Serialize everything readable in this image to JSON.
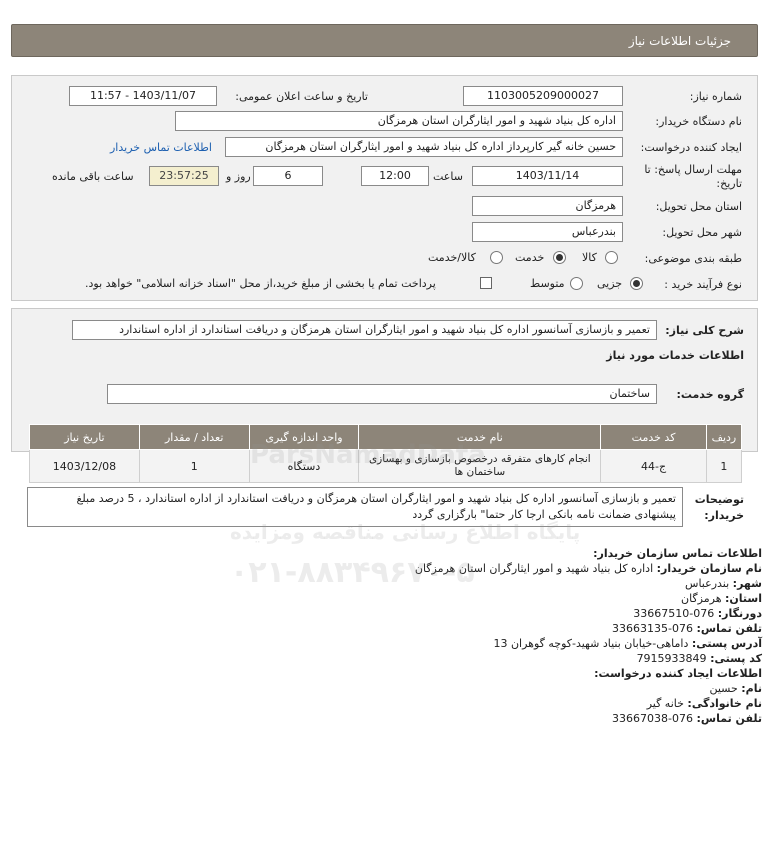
{
  "header": {
    "title": "جزئیات اطلاعات نیاز"
  },
  "form": {
    "need_number_label": "شماره نیاز:",
    "need_number": "1103005209000027",
    "announce_label": "تاریخ و ساعت اعلان عمومی:",
    "announce_value": "1403/11/07 - 11:57",
    "buyer_org_label": "نام دستگاه خریدار:",
    "buyer_org": "اداره کل بنیاد شهید و امور ایثارگران استان هرمزگان",
    "creator_label": "ایجاد کننده درخواست:",
    "creator": "حسین خانه گیر کارپرداز اداره کل بنیاد شهید و امور ایثارگران استان هرمزگان",
    "contact_link": "اطلاعات تماس خریدار",
    "deadline_label": "مهلت ارسال پاسخ: تا تاریخ:",
    "deadline_date": "1403/11/14",
    "time_label": "ساعت",
    "deadline_time": "12:00",
    "days_value": "6",
    "days_label": "روز و",
    "remaining_time": "23:57:25",
    "remaining_label": "ساعت باقی مانده",
    "province_label": "استان محل تحویل:",
    "province": "هرمزگان",
    "city_label": "شهر محل تحویل:",
    "city": "بندرعباس",
    "category_label": "طبقه بندی موضوعی:",
    "category_options": [
      "کالا",
      "خدمت",
      "کالا/خدمت"
    ],
    "category_selected": "خدمت",
    "process_label": "نوع فرآیند خرید :",
    "process_options": [
      "جزیی",
      "متوسط"
    ],
    "process_selected": "جزیی",
    "payment_note": "پرداخت تمام یا بخشی از مبلغ خرید،از محل \"اسناد خزانه اسلامی\" خواهد بود."
  },
  "description": {
    "label": "شرح کلی نیاز:",
    "text": "تعمیر و بازسازی آسانسور اداره کل بنیاد شهید و امور ایثارگران استان هرمزگان و دریافت استاندارد از اداره استاندارد"
  },
  "services": {
    "section_title": "اطلاعات خدمات مورد نیاز",
    "group_label": "گروه خدمت:",
    "group_value": "ساختمان",
    "columns": [
      "ردیف",
      "کد خدمت",
      "نام خدمت",
      "واحد اندازه گیری",
      "تعداد / مقدار",
      "تاریخ نیاز"
    ],
    "rows": [
      {
        "row": "1",
        "code": "ج-44",
        "name": "انجام کارهای متفرقه درخصوص بازسازی و بهسازی ساختمان ها",
        "unit": "دستگاه",
        "qty": "1",
        "date": "1403/12/08"
      }
    ]
  },
  "buyer_notes": {
    "label": "توضیحات خریدار:",
    "text": "تعمیر و بازسازی آسانسور اداره کل بنیاد شهید و امور ایثارگران استان هرمزگان و دریافت استاندارد از اداره استاندارد ، 5 درصد مبلغ پیشنهادی ضمانت نامه بانکی ارجا کار حتما\" بارگزاری گردد"
  },
  "contact": {
    "title": "اطلاعات تماس سازمان خریدار:",
    "org_label": "نام سازمان خریدار:",
    "org": "اداره کل بنیاد شهید و امور ایثارگران استان هرمزگان",
    "city_label": "شهر:",
    "city": "بندرعباس",
    "province_label": "استان:",
    "province": "هرمزگان",
    "fax_label": "دورنگار:",
    "fax": "076-33667510",
    "phone_label": "تلفن تماس:",
    "phone": "076-33663135",
    "address_label": "آدرس پستی:",
    "address": "داماهی-خیابان بنیاد شهید-کوچه گوهران 13",
    "postal_label": "کد پستی:",
    "postal": "7915933849",
    "creator_title": "اطلاعات ایجاد کننده درخواست:",
    "name_label": "نام:",
    "name": "حسین",
    "family_label": "نام خانوادگی:",
    "family": "خانه گیر",
    "creator_phone_label": "تلفن تماس:",
    "creator_phone": "076-33667038"
  },
  "watermark": {
    "line1": "پایگاه اطلاع رسانی مناقصه ومزایده",
    "line2": "ParsNamadData",
    "line3": "۰۲۱-۸۸۳۴۹۶۷۰-۵"
  }
}
